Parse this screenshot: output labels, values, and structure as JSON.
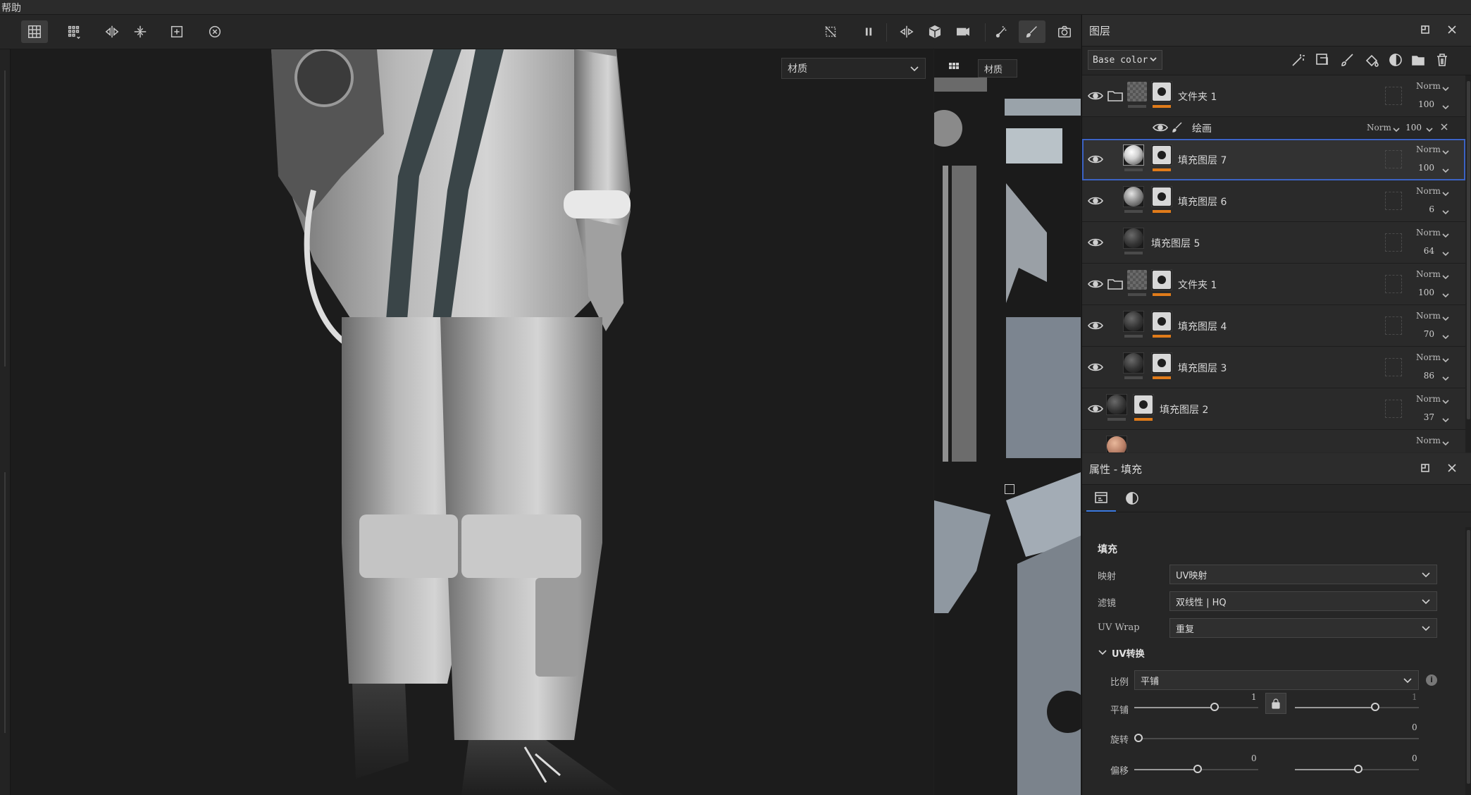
{
  "menubar": {
    "help": "帮助"
  },
  "toolbar": {
    "left_icons": [
      "grid-snap-icon",
      "grid-options-icon",
      "mirror-x-icon",
      "align-icon",
      "add-frame-icon",
      "clock-icon"
    ],
    "right_icons": [
      "hide-icon",
      "pause-icon",
      "symmetry-icon",
      "cube-icon",
      "camera-video-icon",
      "particles-icon",
      "brush-icon",
      "screenshot-icon"
    ]
  },
  "viewport3d": {
    "material_dropdown": "材质"
  },
  "viewport2d": {
    "material_label": "材质"
  },
  "layers_panel": {
    "title": "图层",
    "channel": "Base color",
    "layers": [
      {
        "name": "文件夹 1",
        "blend": "Norm",
        "opacity": "100",
        "type": "folder"
      },
      {
        "name": "绘画",
        "blend": "Norm",
        "opacity": "100",
        "type": "paint"
      },
      {
        "name": "填充图层 7",
        "blend": "Norm",
        "opacity": "100",
        "type": "fill",
        "selected": true
      },
      {
        "name": "填充图层 6",
        "blend": "Norm",
        "opacity": "6",
        "type": "fill"
      },
      {
        "name": "填充图层 5",
        "blend": "Norm",
        "opacity": "64",
        "type": "fill"
      },
      {
        "name": "文件夹 1",
        "blend": "Norm",
        "opacity": "100",
        "type": "folder"
      },
      {
        "name": "填充图层 4",
        "blend": "Norm",
        "opacity": "70",
        "type": "fill"
      },
      {
        "name": "填充图层 3",
        "blend": "Norm",
        "opacity": "86",
        "type": "fill"
      },
      {
        "name": "填充图层 2",
        "blend": "Norm",
        "opacity": "37",
        "type": "fill"
      },
      {
        "name": "",
        "blend": "Norm",
        "opacity": "",
        "type": "fill"
      }
    ]
  },
  "properties_panel": {
    "title": "属性 - 填充",
    "section": "填充",
    "mapping_label": "映射",
    "mapping_value": "UV映射",
    "filter_label": "滤镜",
    "filter_value": "双线性 | HQ",
    "uvwrap_label": "UV Wrap",
    "uvwrap_value": "重复",
    "uv_transform_label": "UV转换",
    "scale_label": "比例",
    "scale_value": "平铺",
    "tiling_label": "平铺",
    "tiling_u": "1",
    "tiling_v": "1",
    "rotation_label": "旋转",
    "rotation_value": "0",
    "offset_label": "偏移",
    "offset_u": "0",
    "offset_v": "0"
  }
}
